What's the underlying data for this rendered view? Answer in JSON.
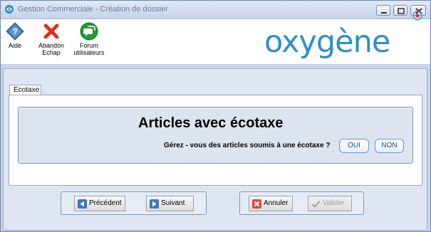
{
  "window": {
    "title": "Gestion Commerciale - Création de dossier"
  },
  "toolbar": {
    "aide_label": "Aide",
    "abandon_label_line1": "Abandon",
    "abandon_label_line2": "Echap",
    "forum_label_line1": "Forum",
    "forum_label_line2": "utilisateurs"
  },
  "logo": {
    "text": "oxygène"
  },
  "tab": {
    "label": "Ecotaxe"
  },
  "content": {
    "heading": "Articles avec écotaxe",
    "question": "Gérez - vous des articles soumis à une écotaxe ?",
    "yes_label": "OUI",
    "no_label": "NON"
  },
  "nav": {
    "prev_label": "Précédent",
    "next_label": "Suivant",
    "cancel_label": "Annuler",
    "validate_label": "Valider",
    "validate_enabled": false
  },
  "icons": {
    "app": "app-icon",
    "help": "help-icon",
    "abandon": "close-icon",
    "forum": "forum-icon",
    "prev": "arrow-left-icon",
    "next": "arrow-right-icon",
    "cancel": "cancel-icon",
    "validate": "check-icon"
  },
  "colors": {
    "accent": "#2f8fc6",
    "pill_text": "#1b4f94",
    "panel_border": "#7f96b8",
    "abandon_red": "#e0301e",
    "forum_green": "#1f9a35"
  }
}
